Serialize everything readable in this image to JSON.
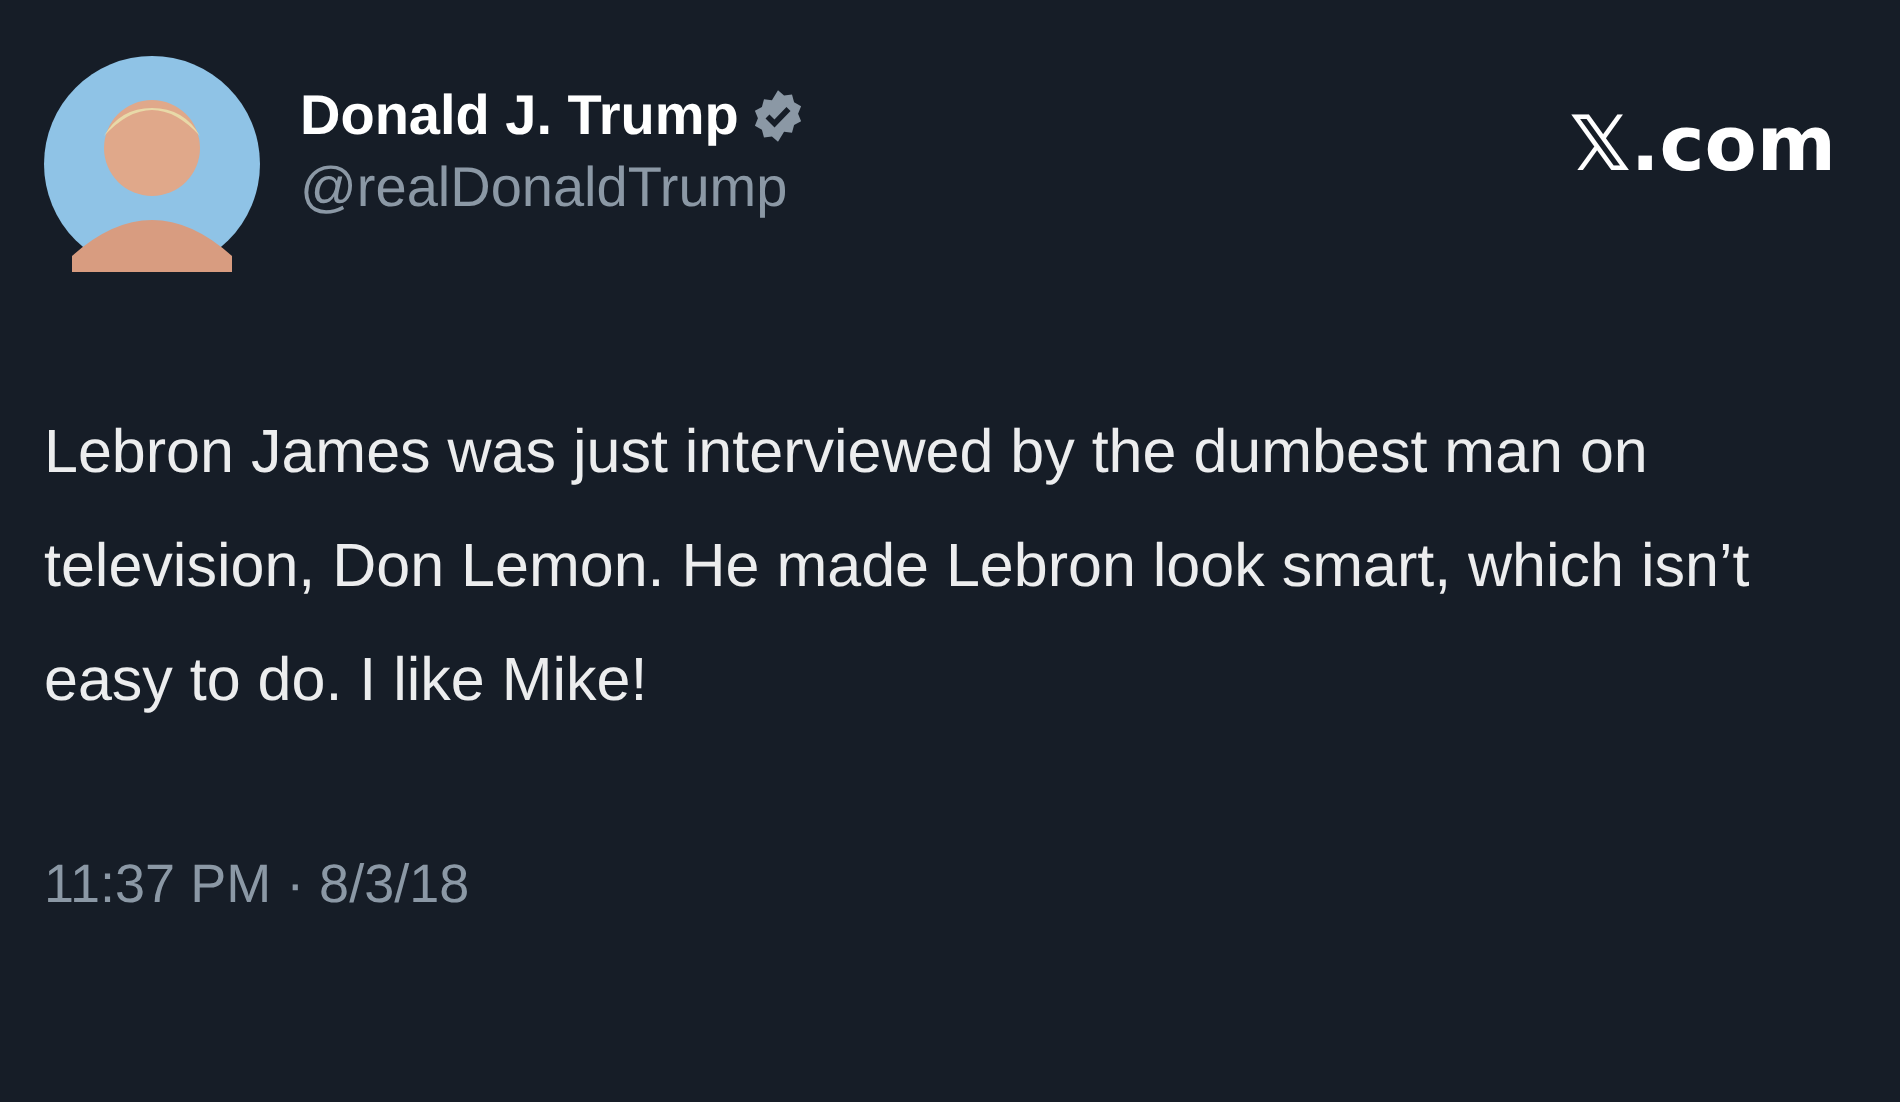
{
  "author": {
    "name": "Donald J. Trump",
    "verified": true,
    "handle": "@realDonaldTrump"
  },
  "site": "𝕏.com",
  "text": "Lebron James was just interviewed by the dumbest man on television, Don Lemon. He made Lebron look smart, which isn’t easy to do. I like Mike!",
  "timestamp": "11:37 PM · 8/3/18"
}
